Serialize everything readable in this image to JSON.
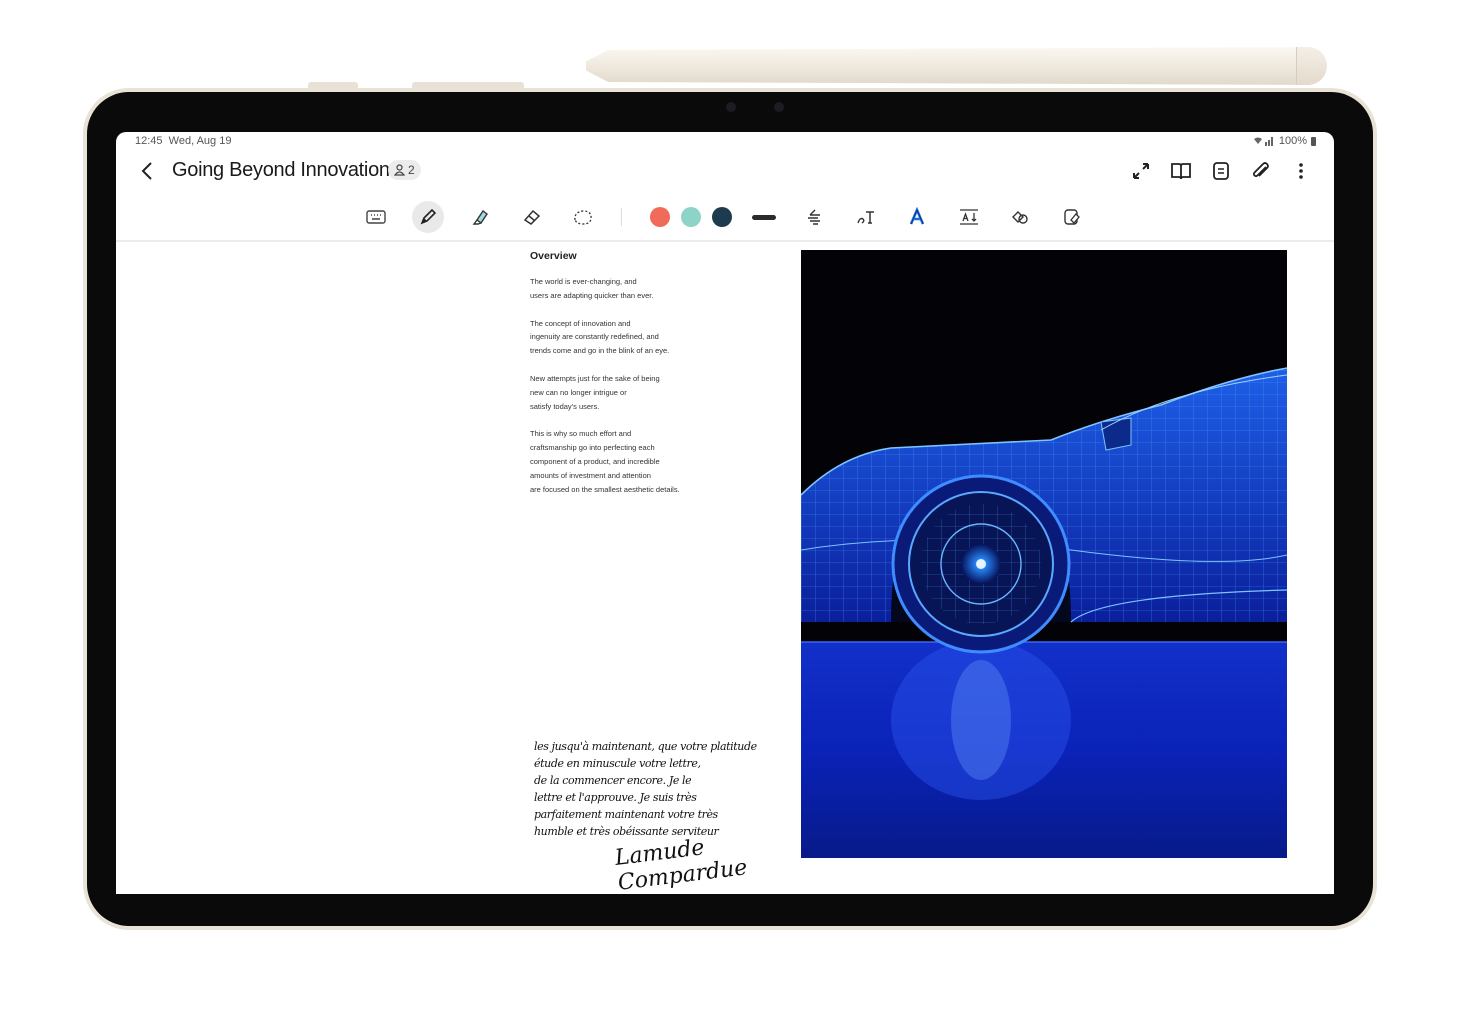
{
  "status_bar": {
    "time": "12:45",
    "date": "Wed, Aug 19",
    "battery": "100%"
  },
  "note": {
    "title": "Going Beyond Innovation",
    "collaborators": "2"
  },
  "title_icons": [
    "resize-icon",
    "book-view-icon",
    "page-icon",
    "attach-icon",
    "more-icon"
  ],
  "toolbar": {
    "tools": [
      "keyboard-icon",
      "pen-icon",
      "highlighter-icon",
      "eraser-icon",
      "lasso-icon"
    ],
    "active_tool": "pen-icon",
    "colors": [
      "#f06b5a",
      "#8ed3c8",
      "#1d3a4f"
    ],
    "extra_tools": [
      "text-style-icon",
      "handwriting-to-text-icon",
      "text-color-icon",
      "text-size-icon",
      "shape-icon",
      "fill-icon"
    ]
  },
  "document": {
    "heading": "Overview",
    "paragraphs": [
      [
        "The world is ever-changing, and",
        "users are adapting quicker than ever."
      ],
      [
        "The concept of innovation and",
        "ingenuity are constantly redefined, and",
        "trends come and go in the blink of an eye."
      ],
      [
        "New attempts just for the sake of being",
        "new can no longer intrigue or",
        "satisfy today's users."
      ],
      [
        "This is why so much effort and",
        "craftsmanship go into perfecting each",
        "component of a product, and incredible",
        "amounts of investment and attention",
        "are focused on the smallest aesthetic details."
      ]
    ]
  },
  "handwriting": {
    "lines": [
      "les jusqu'à maintenant, que votre platitude",
      "étude en minuscule votre lettre,",
      "de la commencer encore. Je le",
      "lettre et l'approuve. Je suis très",
      "parfaitement maintenant votre très",
      "humble et très obéissante serviteur"
    ],
    "signature": "Lamude Compardue"
  }
}
